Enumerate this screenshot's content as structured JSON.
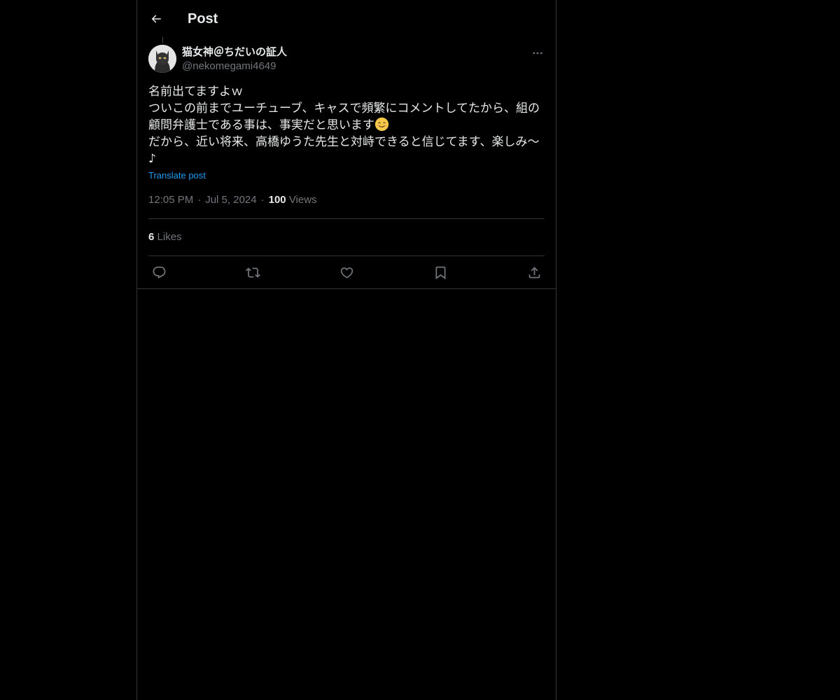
{
  "header": {
    "title": "Post",
    "back_icon": "arrow-left-icon"
  },
  "author": {
    "display_name": "猫女神＠ちだいの証人",
    "handle": "@nekomegami4649",
    "avatar_icon": "cat-avatar"
  },
  "post": {
    "line1": "名前出てますよｗ",
    "line2": "ついこの前までユーチューブ、キャスで頻繁にコメントしてたから、組の顧問弁護士である事は、事実だと思います",
    "emoji": "smiling-face-emoji",
    "line3": "だから、近い将来、高橋ゆうた先生と対峙できると信じてます、楽しみ〜♪",
    "translate_label": "Translate post"
  },
  "meta": {
    "time": "12:05 PM",
    "date": "Jul 5, 2024",
    "separator": "·",
    "views_count": "100",
    "views_label": "Views"
  },
  "engagement": {
    "likes_count": "6",
    "likes_label": "Likes"
  },
  "actions": [
    {
      "name": "reply",
      "icon": "reply-icon"
    },
    {
      "name": "repost",
      "icon": "repost-icon"
    },
    {
      "name": "like",
      "icon": "heart-icon"
    },
    {
      "name": "bookmark",
      "icon": "bookmark-icon"
    },
    {
      "name": "share",
      "icon": "share-icon"
    }
  ],
  "colors": {
    "background": "#000000",
    "text": "#e7e9ea",
    "secondary": "#71767b",
    "link": "#1d9bf0",
    "border": "#2f3336"
  }
}
